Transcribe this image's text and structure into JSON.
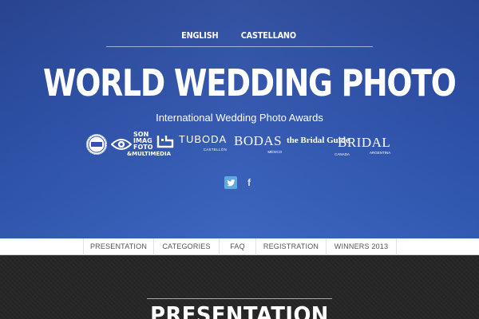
{
  "header": {
    "languages": [
      "ENGLISH",
      "CASTELLANO"
    ],
    "title": "WORLD WEDDING PHOTO",
    "subtitle": "International Wedding Photo Awards"
  },
  "sponsors": {
    "sonimag_lines": [
      "SON",
      "IMAG",
      "FOTO",
      "&MULTIMEDIA"
    ],
    "tuboda": "TUBODA",
    "tuboda_sub": "CASTELLÓN",
    "bodas": "BODAS",
    "bodas_sub": "MÉXICO",
    "bridal_guide": "the Bridal Guide",
    "bridal_guide_sub": "CANADA",
    "bridal": "BRIDAL",
    "bridal_sub": "ARGENTINA"
  },
  "social": {
    "twitter_icon": "twitter-icon",
    "facebook_icon": "facebook-icon"
  },
  "nav": {
    "items": [
      "PRESENTATION",
      "CATEGORIES",
      "FAQ",
      "REGISTRATION",
      "WINNERS 2013"
    ]
  },
  "section": {
    "title": "PRESENTATION"
  },
  "colors": {
    "hero_top": "#2c4a9c",
    "hero_bottom": "#3560bd",
    "dark_bg": "#262626",
    "twitter": "#5ea9dd"
  }
}
